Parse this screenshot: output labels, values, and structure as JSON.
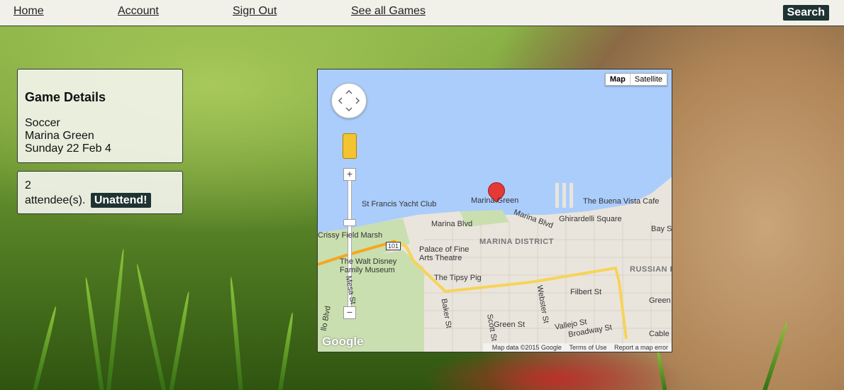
{
  "nav": {
    "links": [
      "Home",
      "Account",
      "Sign Out",
      "See all Games"
    ],
    "search_label": "Search"
  },
  "game": {
    "heading": "Game Details",
    "sport": "Soccer",
    "location": "Marina Green",
    "date": "Sunday 22 Feb 4"
  },
  "attendance": {
    "count": "2",
    "suffix": "attendee(s).",
    "button_label": "Unattend!"
  },
  "map": {
    "type_options": [
      "Map",
      "Satellite"
    ],
    "selected_type": "Map",
    "labels": {
      "st_francis": "St Francis Yacht Club",
      "marina_green": "Marina Green",
      "buena_vista": "The Buena Vista Cafe",
      "ghirardelli": "Ghirardelli Square",
      "bay_st": "Bay St",
      "marina_blvd_1": "Marina Blvd",
      "marina_blvd_2": "Marina Blvd",
      "crissy": "Crissy Field Marsh",
      "marina_district": "MARINA DISTRICT",
      "palace": "Palace of Fine Arts Theatre",
      "disney": "The Walt Disney Family Museum",
      "tipsy": "The Tipsy Pig",
      "russian_hill": "RUSSIAN HI",
      "filbert": "Filbert St",
      "green_st": "Green St",
      "green_st_2": "Green St",
      "vallejo": "Vallejo St",
      "broadway": "Broadway St",
      "cable": "Cable C",
      "baker": "Baker St",
      "scott": "Scott St",
      "webster": "Webster St",
      "mesa": "Mesa St",
      "lvd": "llo Blvd",
      "hwy": "101"
    },
    "attribution": {
      "data": "Map data ©2015 Google",
      "terms": "Terms of Use",
      "report": "Report a map error"
    },
    "logo": "Google",
    "zoom_in": "+",
    "zoom_out": "−",
    "colors": {
      "water": "#abcdfb",
      "land": "#e9e5dc",
      "park": "#c9dfaf",
      "highway": "#f7d35a"
    }
  }
}
